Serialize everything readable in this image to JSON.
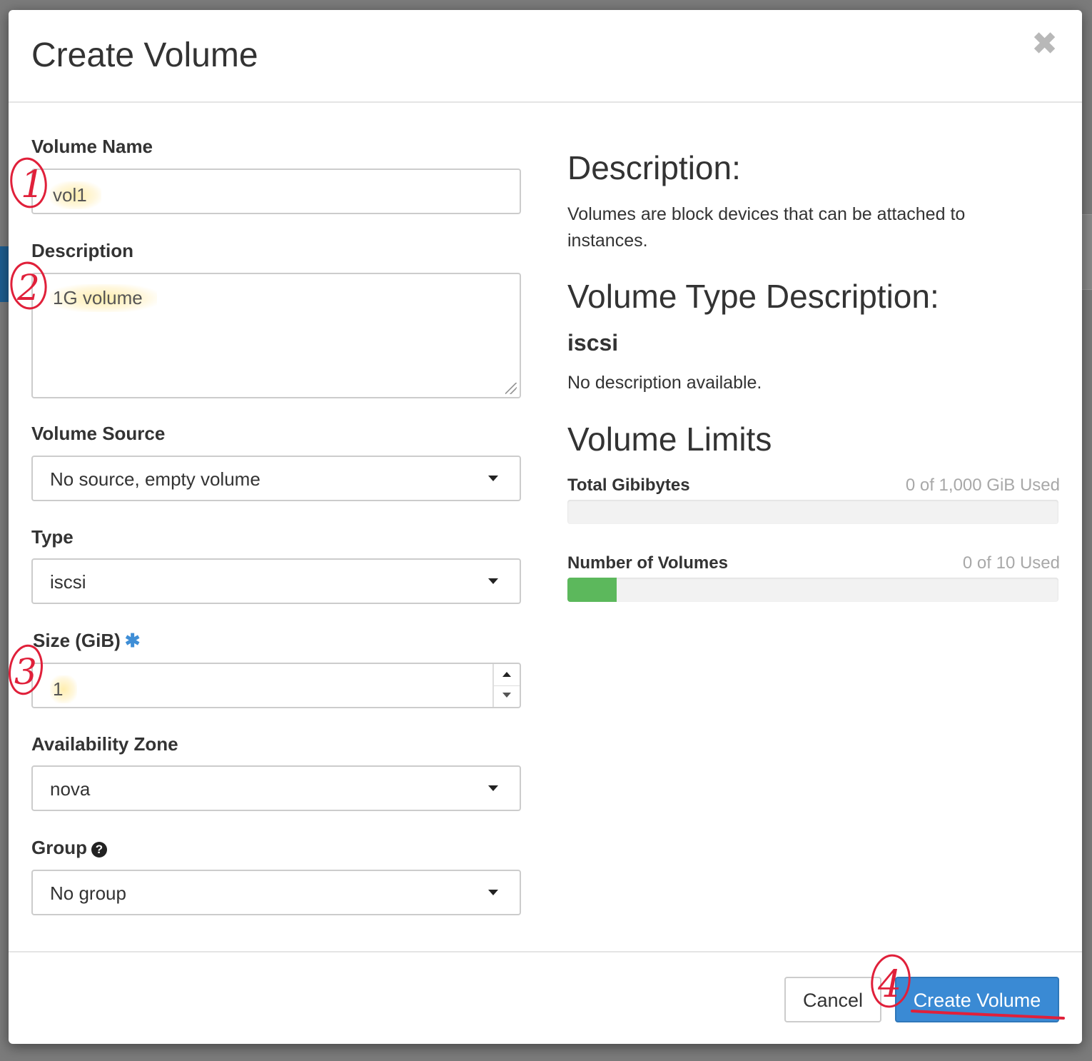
{
  "modal": {
    "title": "Create Volume",
    "close_glyph": "✖"
  },
  "form": {
    "volume_name": {
      "label": "Volume Name",
      "value": "vol1"
    },
    "description": {
      "label": "Description",
      "value": "1G volume"
    },
    "volume_source": {
      "label": "Volume Source",
      "selected": "No source, empty volume"
    },
    "type": {
      "label": "Type",
      "selected": "iscsi"
    },
    "size": {
      "label": "Size (GiB)",
      "required_mark": "✱",
      "value": "1"
    },
    "availability_zone": {
      "label": "Availability Zone",
      "selected": "nova"
    },
    "group": {
      "label": "Group",
      "help_glyph": "?",
      "selected": "No group"
    }
  },
  "info": {
    "description_heading": "Description:",
    "description_text": "Volumes are block devices that can be attached to instances.",
    "type_heading": "Volume Type Description:",
    "type_name": "iscsi",
    "type_text": "No description available.",
    "limits_heading": "Volume Limits",
    "limits": [
      {
        "label": "Total Gibibytes",
        "used_text": "0 of 1,000 GiB Used",
        "fill_percent": 0
      },
      {
        "label": "Number of Volumes",
        "used_text": "0 of 10 Used",
        "fill_percent": 10
      }
    ]
  },
  "footer": {
    "cancel_label": "Cancel",
    "submit_label": "Create Volume"
  },
  "annotations": {
    "markers": [
      "1",
      "2",
      "3",
      "4"
    ],
    "color": "#e0203a"
  },
  "colors": {
    "primary": "#3a8ad4",
    "progress_fill": "#5cb85c",
    "required": "#3f8ed6"
  }
}
